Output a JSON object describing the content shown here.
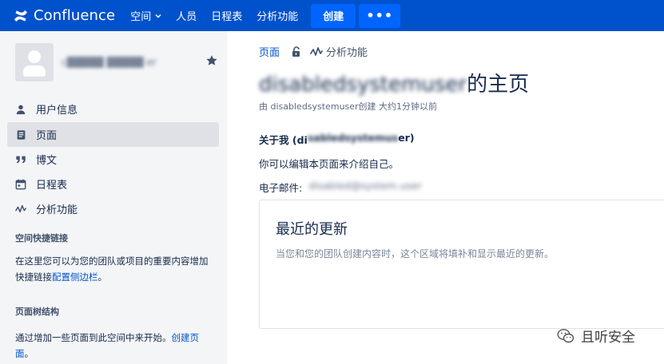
{
  "topnav": {
    "brand": "Confluence",
    "spaces_label": "空间",
    "people_label": "人员",
    "calendar_label": "日程表",
    "analytics_label": "分析功能",
    "create_label": "创建",
    "more_label": "•••"
  },
  "sidebar": {
    "profile_name": "c▓▓▓▓▓ ▓▓▓▓▓ er",
    "items": [
      {
        "label": "用户信息",
        "icon": "user-icon"
      },
      {
        "label": "页面",
        "icon": "page-icon"
      },
      {
        "label": "博文",
        "icon": "quote-icon"
      },
      {
        "label": "日程表",
        "icon": "calendar-icon"
      },
      {
        "label": "分析功能",
        "icon": "analytics-icon"
      }
    ],
    "shortcuts_heading": "空间快捷链接",
    "shortcuts_text_1": "在这里您可以为您的团队或项目的重要内容增加快捷链接",
    "shortcuts_link": "配置侧边栏",
    "shortcuts_text_2": "。",
    "tree_heading": "页面树结构",
    "tree_text_1": "通过增加一些页面到此空间中来开始。",
    "tree_link": "创建页面",
    "tree_text_2": "。"
  },
  "main": {
    "breadcrumb_page": "页面",
    "breadcrumb_analytics": "分析功能",
    "title_obscured": "disabledsystemuser",
    "title_suffix": "的主页",
    "byline": "由 disabledsystemuser创建 大约1分钟以前",
    "about_prefix": "关于我 (di",
    "about_obscured": "sabledsystemus",
    "about_suffix": "er)",
    "about_text": "你可以编辑本页面来介绍自己。",
    "email_label": "电子邮件:",
    "email_obscured": "disabled@system.user",
    "recent_title": "最近的更新",
    "recent_text": "当您和您的团队创建内容时，这个区域将填补和显示最近的更新。"
  },
  "watermark": {
    "text": "且听安全"
  },
  "colors": {
    "topnav_bg": "#0052cc",
    "button_bg": "#0065ff",
    "sidebar_bg": "#f4f5f7",
    "active_item_bg": "#dfe1e6",
    "link": "#0052cc"
  }
}
